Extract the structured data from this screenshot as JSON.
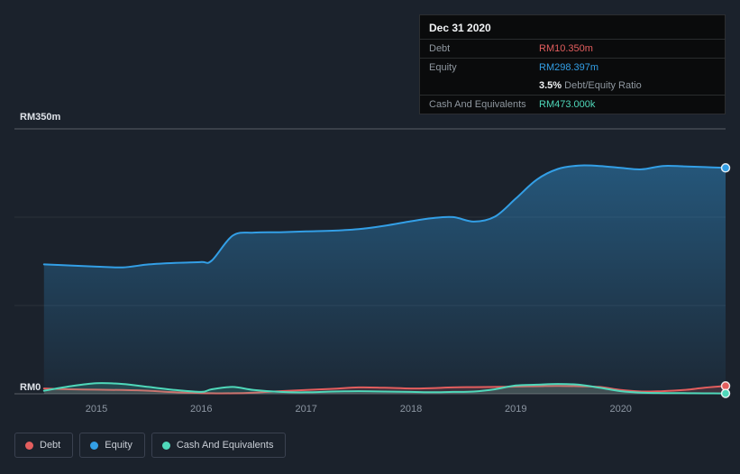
{
  "tooltip": {
    "title": "Dec 31 2020",
    "debt_label": "Debt",
    "debt_value": "RM10.350m",
    "equity_label": "Equity",
    "equity_value": "RM298.397m",
    "ratio_value": "3.5%",
    "ratio_label": "Debt/Equity Ratio",
    "cash_label": "Cash And Equivalents",
    "cash_value": "RM473.000k"
  },
  "legend": {
    "items": [
      {
        "label": "Debt",
        "color": "#e35e5e"
      },
      {
        "label": "Equity",
        "color": "#339fe6"
      },
      {
        "label": "Cash And Equivalents",
        "color": "#4fd8ba"
      }
    ]
  },
  "chart_data": {
    "type": "area",
    "title": "",
    "ylabel_top": "RM350m",
    "ylabel_bottom": "RM0",
    "y_range": [
      0,
      350
    ],
    "x_range": [
      2014.218,
      2021.0
    ],
    "x_ticks": [
      2015,
      2016,
      2017,
      2018,
      2019,
      2020
    ],
    "grid_values": [
      350,
      233.33,
      116.67,
      0
    ],
    "grid": "horizontal",
    "legend_position": "bottom-left",
    "colors": {
      "background": "#1b222c",
      "axis_text": "#8b95a1",
      "y_label_text": "#dfe3e9",
      "grid_strong": "rgba(255,255,255,0.28)",
      "grid_faint": "rgba(255,255,255,0.07)"
    },
    "series": [
      {
        "name": "Equity",
        "color": "#339fe6",
        "fill": "gradient",
        "x": [
          2014.5,
          2014.75,
          2015.0,
          2015.25,
          2015.5,
          2015.75,
          2016.0,
          2016.1,
          2016.3,
          2016.5,
          2016.75,
          2017.0,
          2017.25,
          2017.5,
          2017.75,
          2018.0,
          2018.2,
          2018.4,
          2018.6,
          2018.8,
          2019.0,
          2019.2,
          2019.4,
          2019.6,
          2019.8,
          2020.0,
          2020.2,
          2020.4,
          2020.6,
          2020.8,
          2021.0
        ],
        "values": [
          171,
          169.5,
          168,
          167,
          171,
          173,
          174,
          176,
          209,
          213,
          213.5,
          214.5,
          215.5,
          217.5,
          222,
          228,
          232,
          233.5,
          227.5,
          234,
          258,
          283,
          297,
          301.5,
          301,
          298.5,
          296.5,
          301,
          300.5,
          299.5,
          298.397
        ]
      },
      {
        "name": "Debt",
        "color": "#e35e5e",
        "fill": "flat",
        "x": [
          2014.5,
          2014.75,
          2015.0,
          2015.25,
          2015.5,
          2015.75,
          2016.0,
          2016.1,
          2016.3,
          2016.5,
          2016.75,
          2017.0,
          2017.25,
          2017.5,
          2017.75,
          2018.0,
          2018.2,
          2018.4,
          2018.6,
          2018.8,
          2019.0,
          2019.2,
          2019.4,
          2019.6,
          2019.8,
          2020.0,
          2020.2,
          2020.4,
          2020.6,
          2020.8,
          2021.0
        ],
        "values": [
          7,
          6,
          5.5,
          5,
          4,
          2,
          1,
          0.7,
          0.7,
          1.5,
          3.5,
          5,
          6.5,
          8.5,
          8,
          7,
          7.5,
          8.5,
          8.8,
          9,
          9.5,
          10,
          10.5,
          10,
          9,
          5,
          3,
          3.5,
          5,
          8,
          10.35
        ]
      },
      {
        "name": "Cash And Equivalents",
        "color": "#4fd8ba",
        "fill": "flat",
        "x": [
          2014.5,
          2014.75,
          2015.0,
          2015.25,
          2015.5,
          2015.75,
          2016.0,
          2016.1,
          2016.3,
          2016.5,
          2016.75,
          2017.0,
          2017.25,
          2017.5,
          2017.75,
          2018.0,
          2018.2,
          2018.4,
          2018.6,
          2018.8,
          2019.0,
          2019.2,
          2019.4,
          2019.6,
          2019.8,
          2020.0,
          2020.2,
          2020.4,
          2020.6,
          2020.8,
          2021.0
        ],
        "values": [
          4,
          10,
          14,
          13,
          9,
          5,
          2.5,
          6,
          9,
          5,
          2.5,
          2,
          3,
          3.5,
          3,
          2.5,
          2,
          2.5,
          3,
          6,
          11,
          12,
          13,
          12,
          8,
          3.5,
          1.5,
          1,
          0.8,
          0.6,
          0.473
        ]
      }
    ]
  }
}
